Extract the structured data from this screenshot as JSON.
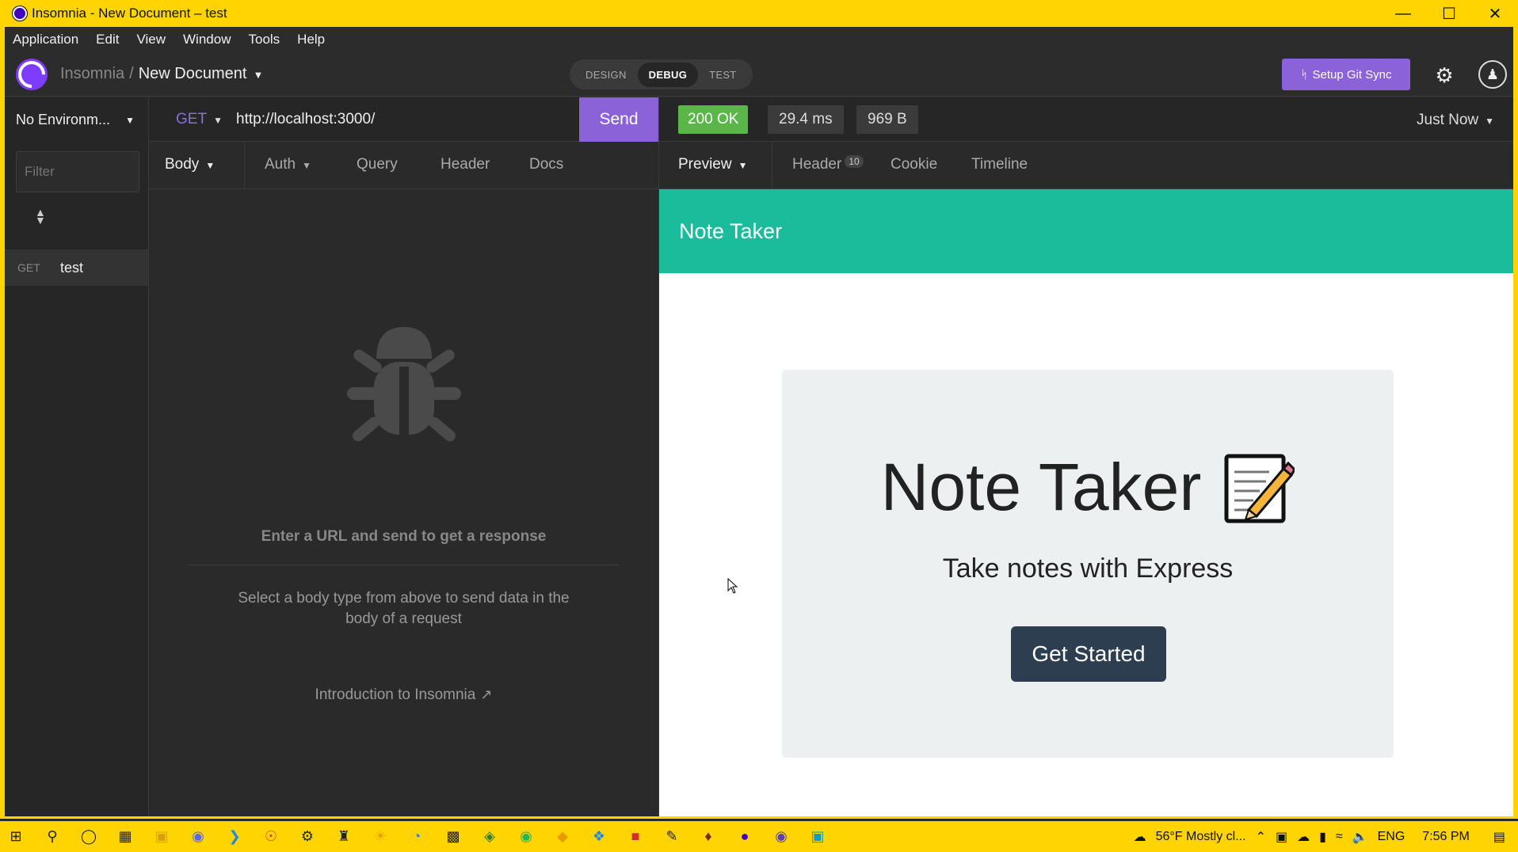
{
  "window": {
    "title": "Insomnia - New Document – test"
  },
  "menu": [
    "Application",
    "Edit",
    "View",
    "Window",
    "Tools",
    "Help"
  ],
  "header": {
    "crumb_app": "Insomnia",
    "crumb_sep": "/",
    "crumb_doc": "New Document",
    "modes": [
      "DESIGN",
      "DEBUG",
      "TEST"
    ],
    "git_sync_label": "Setup Git Sync"
  },
  "sidebar": {
    "environment": "No Environm...",
    "filter_placeholder": "Filter",
    "requests": [
      {
        "method": "GET",
        "name": "test"
      }
    ]
  },
  "request": {
    "method": "GET",
    "url": "http://localhost:3000/",
    "send_label": "Send",
    "tabs": [
      "Body",
      "Auth",
      "Query",
      "Header",
      "Docs"
    ],
    "empty_title": "Enter a URL and send to get a response",
    "empty_desc": "Select a body type from above to send data in the body of a request",
    "intro_link": "Introduction to Insomnia"
  },
  "response": {
    "status": "200 OK",
    "time": "29.4 ms",
    "size": "969 B",
    "timestamp": "Just Now",
    "tabs": [
      "Preview",
      "Header",
      "Cookie",
      "Timeline"
    ],
    "header_count": "10",
    "preview": {
      "brand": "Note Taker",
      "title": "Note Taker",
      "subtitle": "Take notes with Express",
      "button": "Get Started"
    }
  },
  "taskbar": {
    "weather": "56°F Mostly cl...",
    "lang": "ENG",
    "time": "7:56 PM"
  },
  "colors": {
    "titlebar": "#ffd400",
    "accent": "#8b62d8",
    "status_ok": "#5bb64a",
    "preview_nav": "#1abc9c",
    "button_dark": "#2c3e50"
  }
}
